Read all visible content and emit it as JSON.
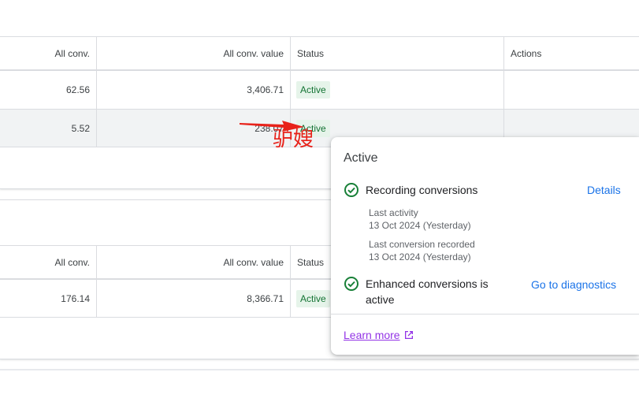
{
  "table1": {
    "headers": {
      "all_conv": "All conv.",
      "all_conv_value": "All conv. value",
      "status": "Status",
      "actions": "Actions"
    },
    "rows": [
      {
        "all_conv": "62.56",
        "all_conv_value": "3,406.71",
        "status": "Active"
      },
      {
        "all_conv": "5.52",
        "all_conv_value": "238.07",
        "status": "Active"
      }
    ]
  },
  "table2": {
    "headers": {
      "all_conv": "All conv.",
      "all_conv_value": "All conv. value",
      "status": "Status"
    },
    "rows": [
      {
        "all_conv": "176.14",
        "all_conv_value": "8,366.71",
        "status": "Active"
      }
    ]
  },
  "annotation": {
    "handwritten_text": "驴嫂",
    "color": "#e8221a"
  },
  "popover": {
    "title": "Active",
    "recording": {
      "label": "Recording conversions",
      "link": "Details",
      "icon": "check-circle-icon",
      "last_activity_label": "Last activity",
      "last_activity_value": "13 Oct 2024 (Yesterday)",
      "last_conversion_label": "Last conversion recorded",
      "last_conversion_value": "13 Oct 2024 (Yesterday)"
    },
    "enhanced": {
      "label_line1": "Enhanced conversions is",
      "label_line2": "active",
      "link": "Go to diagnostics",
      "icon": "check-circle-icon"
    },
    "learn_more": "Learn more"
  },
  "colors": {
    "link": "#1a73e8",
    "check": "#188038",
    "chip_bg": "#e6f4ea",
    "chip_text": "#137333",
    "visited_link": "#9334e6"
  }
}
